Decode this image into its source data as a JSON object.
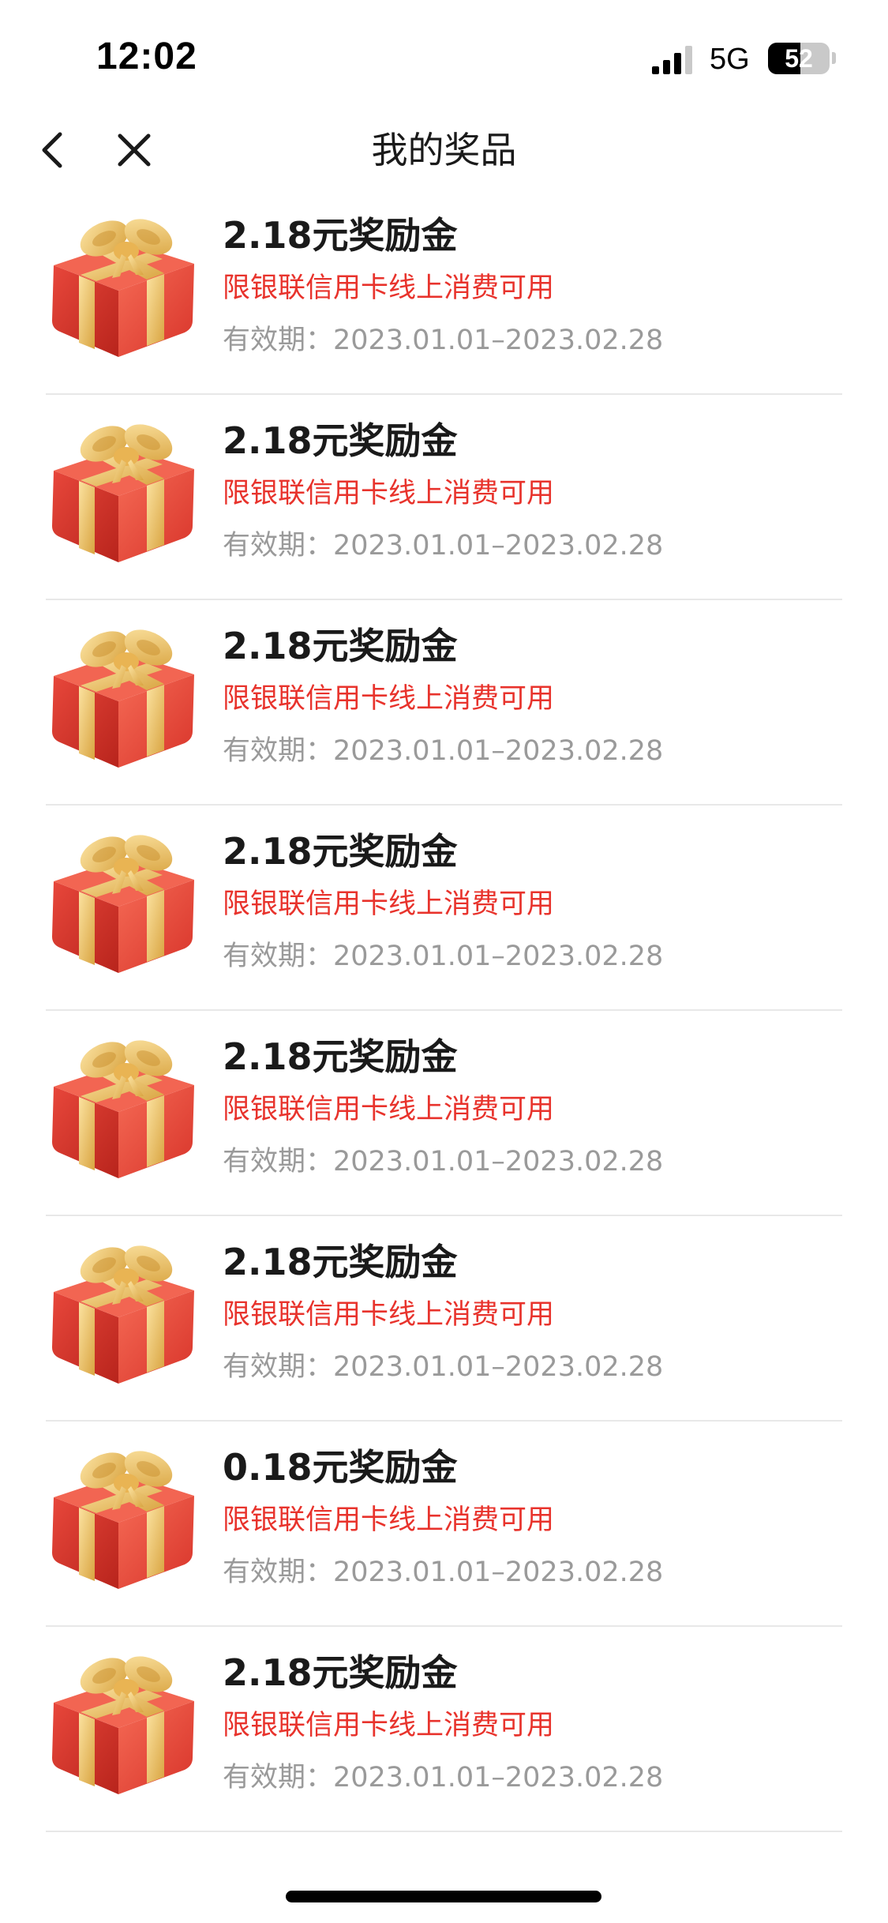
{
  "status_bar": {
    "time": "12:02",
    "network": "5G",
    "battery_level": "52",
    "battery_fraction": 0.52,
    "signal_bars_active": 3,
    "signal_bars_total": 4
  },
  "header": {
    "title": "我的奖品",
    "back_icon": "chevron-left-icon",
    "close_icon": "close-icon"
  },
  "colors": {
    "desc_red": "#e8332c",
    "validity_gray": "#9a9a9a",
    "gift_red": "#e8473b",
    "gift_gold": "#f0c463"
  },
  "prizes": [
    {
      "title": "2.18元奖励金",
      "desc": "限银联信用卡线上消费可用",
      "validity": "有效期：2023.01.01–2023.02.28"
    },
    {
      "title": "2.18元奖励金",
      "desc": "限银联信用卡线上消费可用",
      "validity": "有效期：2023.01.01–2023.02.28"
    },
    {
      "title": "2.18元奖励金",
      "desc": "限银联信用卡线上消费可用",
      "validity": "有效期：2023.01.01–2023.02.28"
    },
    {
      "title": "2.18元奖励金",
      "desc": "限银联信用卡线上消费可用",
      "validity": "有效期：2023.01.01–2023.02.28"
    },
    {
      "title": "2.18元奖励金",
      "desc": "限银联信用卡线上消费可用",
      "validity": "有效期：2023.01.01–2023.02.28"
    },
    {
      "title": "2.18元奖励金",
      "desc": "限银联信用卡线上消费可用",
      "validity": "有效期：2023.01.01–2023.02.28"
    },
    {
      "title": "0.18元奖励金",
      "desc": "限银联信用卡线上消费可用",
      "validity": "有效期：2023.01.01–2023.02.28"
    },
    {
      "title": "2.18元奖励金",
      "desc": "限银联信用卡线上消费可用",
      "validity": "有效期：2023.01.01–2023.02.28"
    }
  ]
}
